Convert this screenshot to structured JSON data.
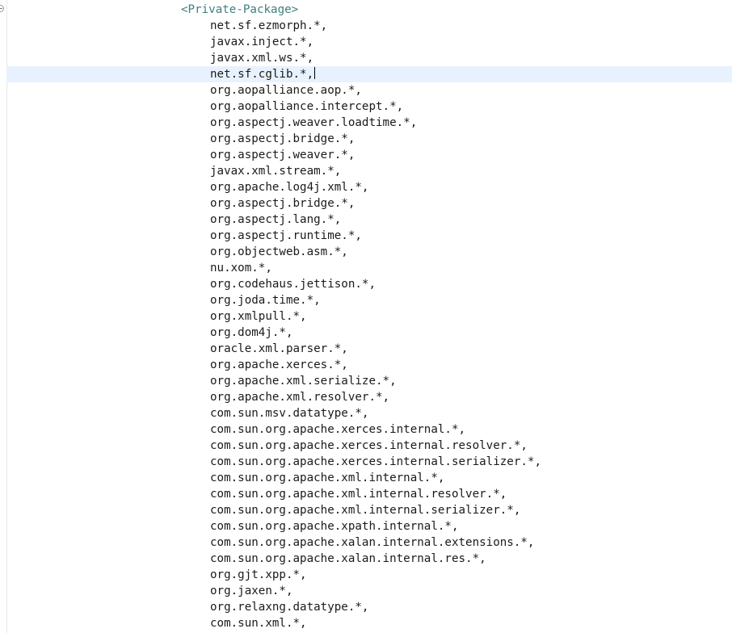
{
  "editor": {
    "tag": "<Private-Package>",
    "lines": [
      "net.sf.ezmorph.*,",
      "javax.inject.*,",
      "javax.xml.ws.*,",
      "net.sf.cglib.*,",
      "org.aopalliance.aop.*,",
      "org.aopalliance.intercept.*,",
      "org.aspectj.weaver.loadtime.*,",
      "org.aspectj.bridge.*,",
      "org.aspectj.weaver.*,",
      "javax.xml.stream.*,",
      "org.apache.log4j.xml.*,",
      "org.aspectj.bridge.*,",
      "org.aspectj.lang.*,",
      "org.aspectj.runtime.*,",
      "org.objectweb.asm.*,",
      "nu.xom.*,",
      "org.codehaus.jettison.*,",
      "org.joda.time.*,",
      "org.xmlpull.*,",
      "org.dom4j.*,",
      "oracle.xml.parser.*,",
      "org.apache.xerces.*,",
      "org.apache.xml.serialize.*,",
      "org.apache.xml.resolver.*,",
      "com.sun.msv.datatype.*,",
      "com.sun.org.apache.xerces.internal.*,",
      "com.sun.org.apache.xerces.internal.resolver.*,",
      "com.sun.org.apache.xerces.internal.serializer.*,",
      "com.sun.org.apache.xml.internal.*,",
      "com.sun.org.apache.xml.internal.resolver.*,",
      "com.sun.org.apache.xml.internal.serializer.*,",
      "com.sun.org.apache.xpath.internal.*,",
      "com.sun.org.apache.xalan.internal.extensions.*,",
      "com.sun.org.apache.xalan.internal.res.*,",
      "org.gjt.xpp.*,",
      "org.jaxen.*,",
      "org.relaxng.datatype.*,",
      "com.sun.xml.*,"
    ],
    "current_line_index": 3,
    "colors": {
      "tag": "#3f7f7f",
      "text": "#1a1a1a",
      "current_line_highlight": "#e8f2fe",
      "background": "#ffffff"
    }
  }
}
